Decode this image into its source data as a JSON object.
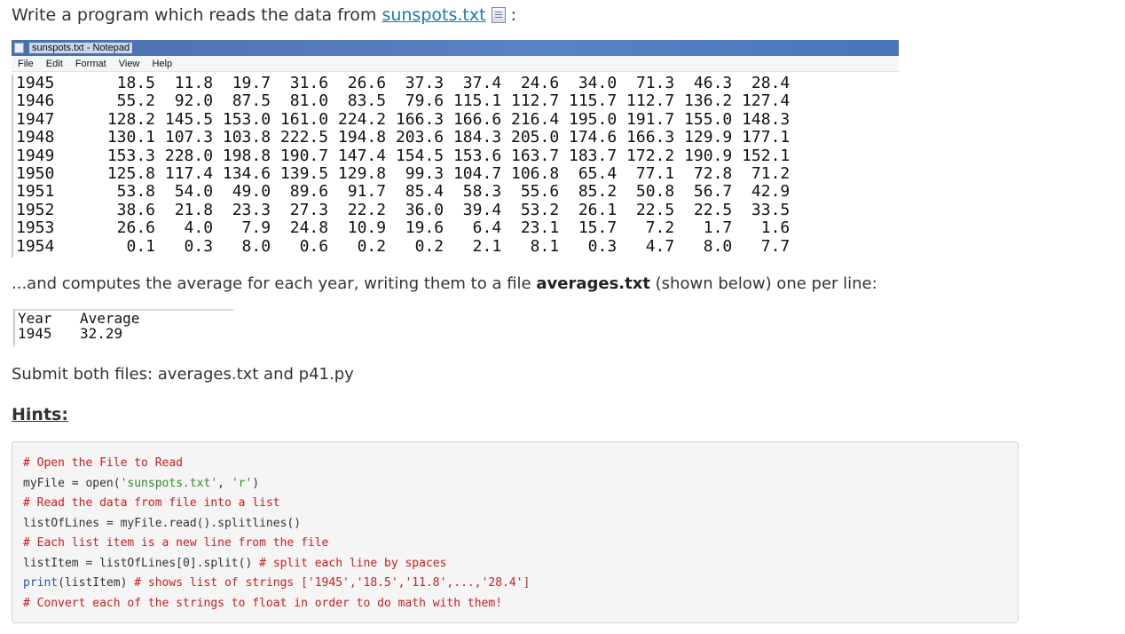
{
  "intro": {
    "text_before": "Write a program which reads the  data from ",
    "link": "sunspots.txt",
    "text_after": " :",
    "icon": "file-icon"
  },
  "notepad": {
    "title": "sunspots.txt - Notepad",
    "menu": [
      "File",
      "Edit",
      "Format",
      "View",
      "Help"
    ],
    "rows": [
      {
        "year": "1945",
        "values": "  18.5  11.8  19.7  31.6  26.6  37.3  37.4  24.6  34.0  71.3  46.3  28.4"
      },
      {
        "year": "1946",
        "values": "  55.2  92.0  87.5  81.0  83.5  79.6 115.1 112.7 115.7 112.7 136.2 127.4"
      },
      {
        "year": "1947",
        "values": " 128.2 145.5 153.0 161.0 224.2 166.3 166.6 216.4 195.0 191.7 155.0 148.3"
      },
      {
        "year": "1948",
        "values": " 130.1 107.3 103.8 222.5 194.8 203.6 184.3 205.0 174.6 166.3 129.9 177.1"
      },
      {
        "year": "1949",
        "values": " 153.3 228.0 198.8 190.7 147.4 154.5 153.6 163.7 183.7 172.2 190.9 152.1"
      },
      {
        "year": "1950",
        "values": " 125.8 117.4 134.6 139.5 129.8  99.3 104.7 106.8  65.4  77.1  72.8  71.2"
      },
      {
        "year": "1951",
        "values": "  53.8  54.0  49.0  89.6  91.7  85.4  58.3  55.6  85.2  50.8  56.7  42.9"
      },
      {
        "year": "1952",
        "values": "  38.6  21.8  23.3  27.3  22.2  36.0  39.4  53.2  26.1  22.5  22.5  33.5"
      },
      {
        "year": "1953",
        "values": "  26.6   4.0   7.9  24.8  10.9  19.6   6.4  23.1  15.7   7.2   1.7   1.6"
      },
      {
        "year": "1954",
        "values": "   0.1   0.3   8.0   0.6   0.2   0.2   2.1   8.1   0.3   4.7   8.0   7.7"
      }
    ]
  },
  "para2": {
    "text_before": "...and computes the average for each year, writing them to a file ",
    "bold": "averages.txt",
    "text_after": " (shown below) one per line:"
  },
  "averages": {
    "header": [
      "Year",
      "Average"
    ],
    "row": [
      "1945",
      "32.29"
    ]
  },
  "submit_text": "Submit both files: averages.txt and p41.py",
  "hints_label": "Hints:",
  "code": {
    "line1": "# Open the File to Read",
    "line2_a": "myFile = open(",
    "line2_s1": "'sunspots.txt'",
    "line2_b": ", ",
    "line2_s2": "'r'",
    "line2_c": ")",
    "line3": "# Read the data from file into a list",
    "line4": "listOfLines = myFile.read().splitlines()",
    "line5": "# Each list item is a new line from the file",
    "line6_a": "listItem = listOfLines[0].split() ",
    "line6_c": "# split each line by spaces",
    "line7_kw": "print",
    "line7_a": "(listItem) ",
    "line7_c": "# shows list of strings ['1945','18.5','11.8',...,'28.4']",
    "line8": "# Convert each of the strings to float in order to do math with them!"
  }
}
